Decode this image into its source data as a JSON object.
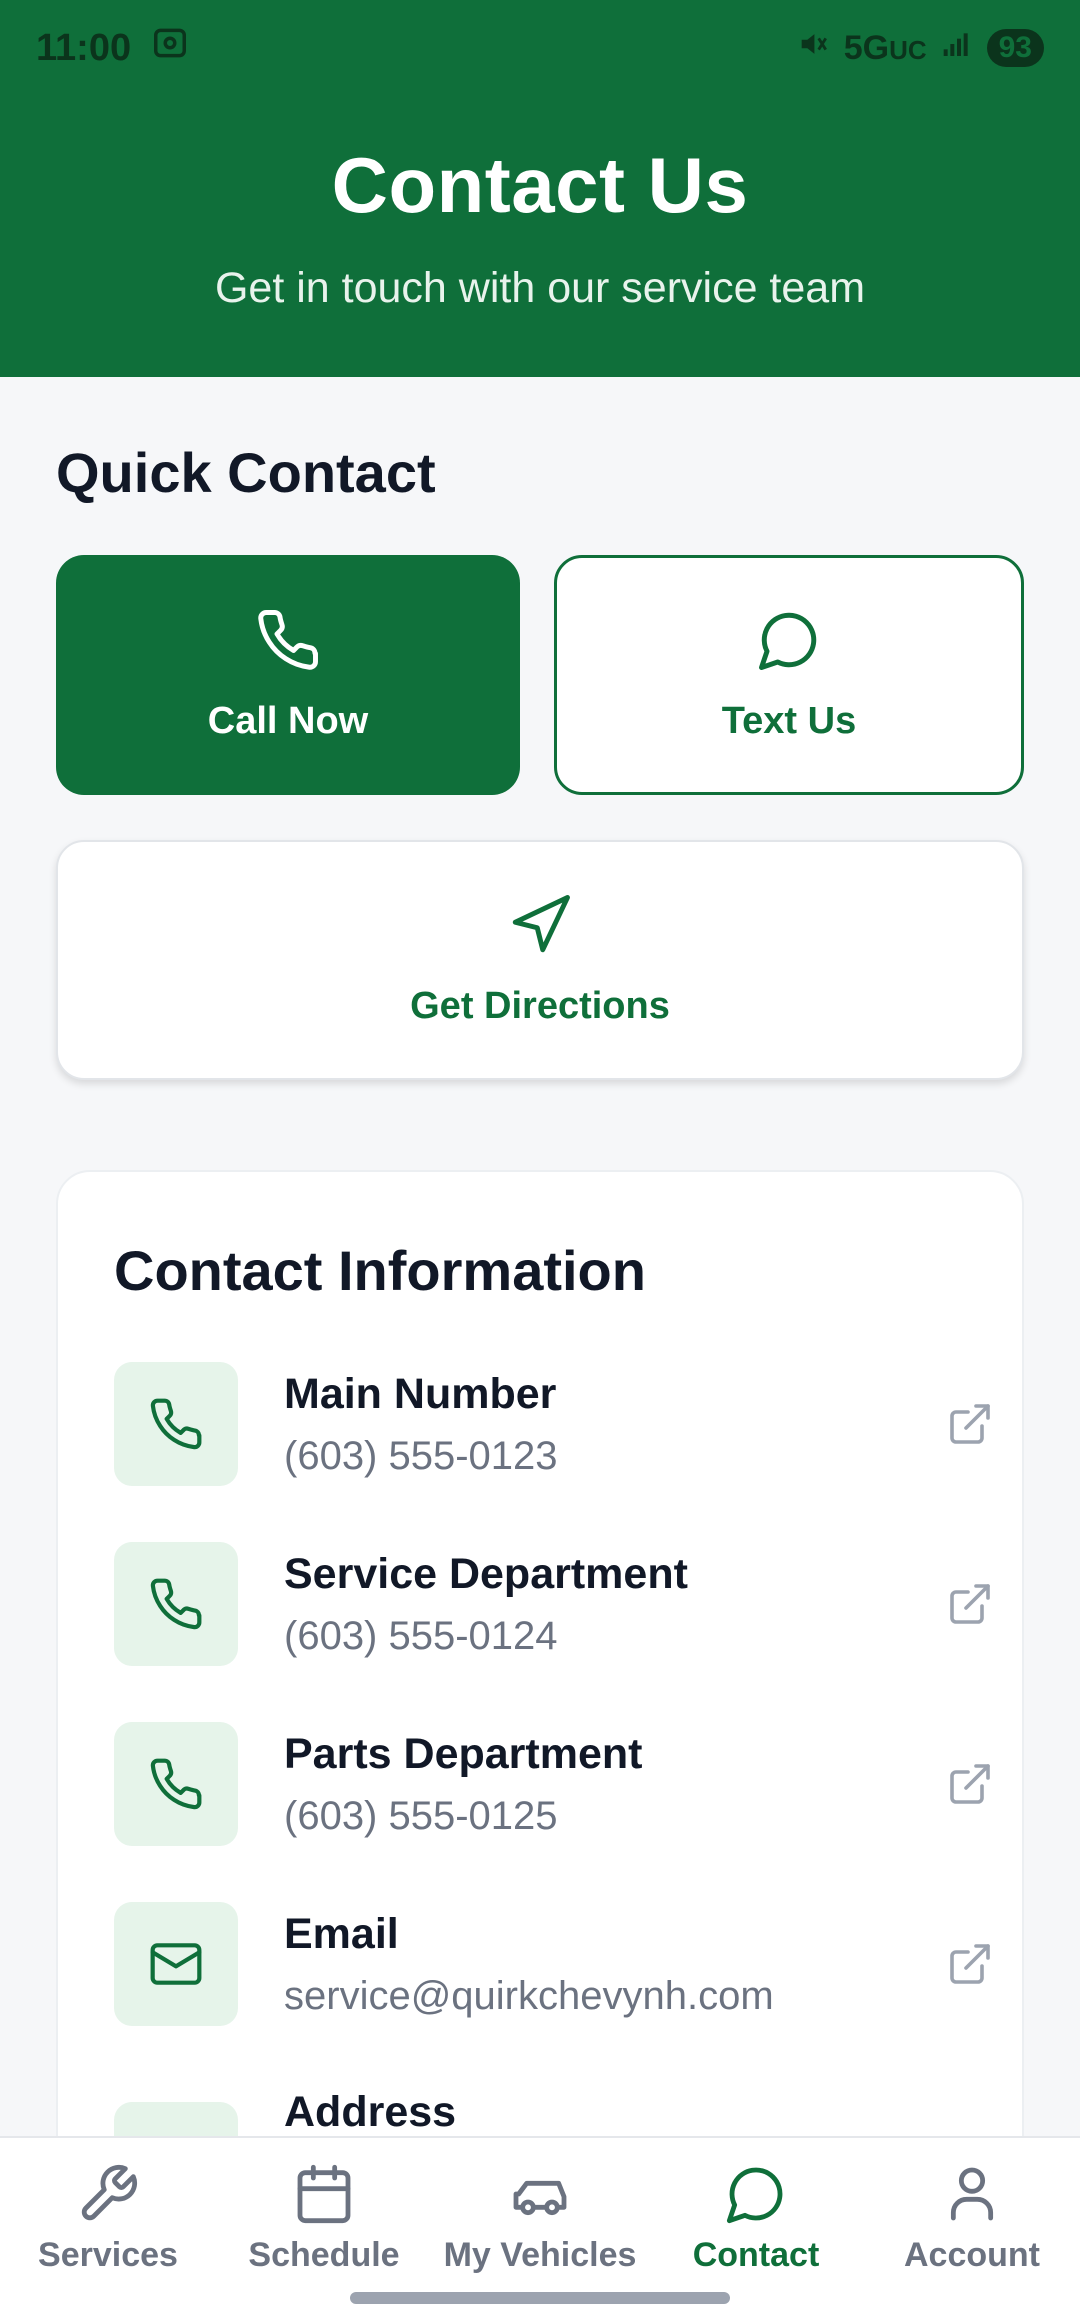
{
  "status_bar": {
    "time": "11:00",
    "network": "5G",
    "network_suffix": "UC",
    "battery": "93"
  },
  "header": {
    "title": "Contact Us",
    "subtitle": "Get in touch with our service team"
  },
  "quick_contact": {
    "title": "Quick Contact",
    "call_label": "Call Now",
    "text_label": "Text Us",
    "directions_label": "Get Directions"
  },
  "contact_info": {
    "title": "Contact Information",
    "items": [
      {
        "label": "Main Number",
        "value": "(603) 555-0123",
        "icon": "phone-icon"
      },
      {
        "label": "Service Department",
        "value": "(603) 555-0124",
        "icon": "phone-icon"
      },
      {
        "label": "Parts Department",
        "value": "(603) 555-0125",
        "icon": "phone-icon"
      },
      {
        "label": "Email",
        "value": "service@quirkchevynh.com",
        "icon": "mail-icon"
      },
      {
        "label": "Address",
        "value": "",
        "icon": "map-pin-icon"
      }
    ]
  },
  "bottom_nav": {
    "items": [
      {
        "label": "Services",
        "icon": "wrench-icon"
      },
      {
        "label": "Schedule",
        "icon": "calendar-icon"
      },
      {
        "label": "My Vehicles",
        "icon": "car-icon"
      },
      {
        "label": "Contact",
        "icon": "message-icon",
        "active": true
      },
      {
        "label": "Account",
        "icon": "user-icon"
      }
    ]
  },
  "colors": {
    "primary": "#0f6f3a",
    "icon_bg": "#e6f4ea",
    "muted_text": "#6b7280"
  }
}
